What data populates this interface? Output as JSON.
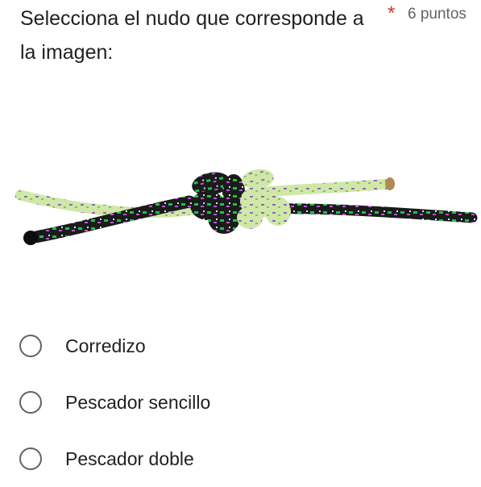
{
  "question": {
    "title": "Selecciona el nudo que corresponde a la imagen:",
    "required_marker": "*",
    "points": "6 puntos"
  },
  "image": {
    "subject": "knot"
  },
  "options": [
    {
      "label": "Corredizo",
      "selected": false
    },
    {
      "label": "Pescador sencillo",
      "selected": false
    },
    {
      "label": "Pescador doble",
      "selected": false
    }
  ],
  "colors": {
    "text": "#202124",
    "secondary_text": "#5f6368",
    "required": "#d93025",
    "radio_border": "#5f6368",
    "rope_light_green": "#c8e6a0",
    "rope_dark": "#1e1e1e",
    "rope_green_accent": "#22c55e",
    "rope_purple_accent": "#a855f7"
  }
}
